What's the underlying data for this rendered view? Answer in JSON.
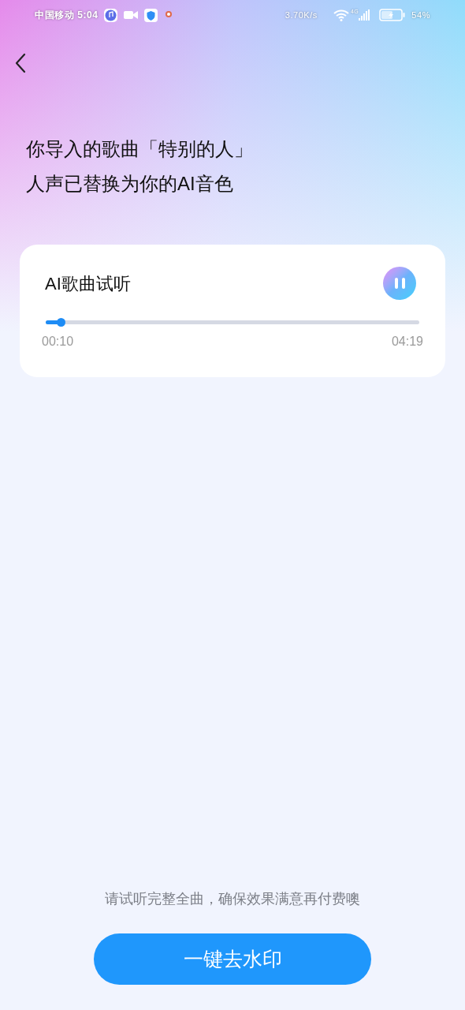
{
  "status_bar": {
    "carrier": "中国移动",
    "time": "5:04",
    "speed": "3.70K/s",
    "network": "4G",
    "battery": "54%"
  },
  "heading": [
    "你导入的歌曲「特别的人」",
    "人声已替换为你的AI音色"
  ],
  "player": {
    "title": "AI歌曲试听",
    "playing": true,
    "level": 0.04,
    "elapsed": "00:10",
    "total": "04:19"
  },
  "notice": "请试听完整全曲，确保效果满意再付费噢",
  "button": "一键去水印"
}
